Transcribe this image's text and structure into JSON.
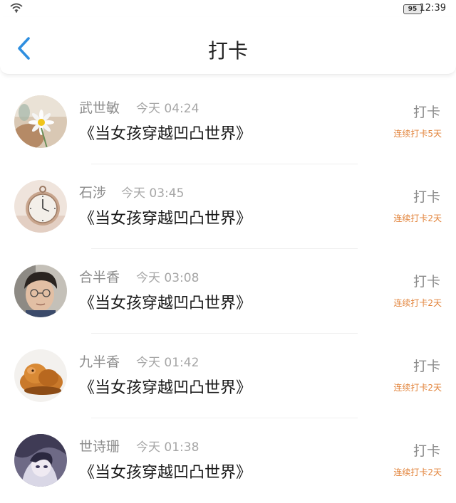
{
  "status_bar": {
    "battery": "95",
    "time": "12:39"
  },
  "header": {
    "title": "打卡"
  },
  "feed": [
    {
      "name": "武世敏",
      "time": "今天 04:24",
      "book": "《当女孩穿越凹凸世界》",
      "action": "打卡",
      "streak": "连续打卡5天",
      "avatar": "daisy-photo"
    },
    {
      "name": "石涉",
      "time": "今天 03:45",
      "book": "《当女孩穿越凹凸世界》",
      "action": "打卡",
      "streak": "连续打卡2天",
      "avatar": "pocket-watch-photo"
    },
    {
      "name": "合半香",
      "time": "今天 03:08",
      "book": "《当女孩穿越凹凸世界》",
      "action": "打卡",
      "streak": "连续打卡2天",
      "avatar": "selfie-photo"
    },
    {
      "name": "九半香",
      "time": "今天 01:42",
      "book": "《当女孩穿越凹凸世界》",
      "action": "打卡",
      "streak": "连续打卡2天",
      "avatar": "wooden-carving-photo"
    },
    {
      "name": "世诗珊",
      "time": "今天 01:38",
      "book": "《当女孩穿越凹凸世界》",
      "action": "打卡",
      "streak": "连续打卡2天",
      "avatar": "anime-portrait"
    }
  ],
  "colors": {
    "accent": "#2f8fe0",
    "streak": "#e2833a"
  }
}
